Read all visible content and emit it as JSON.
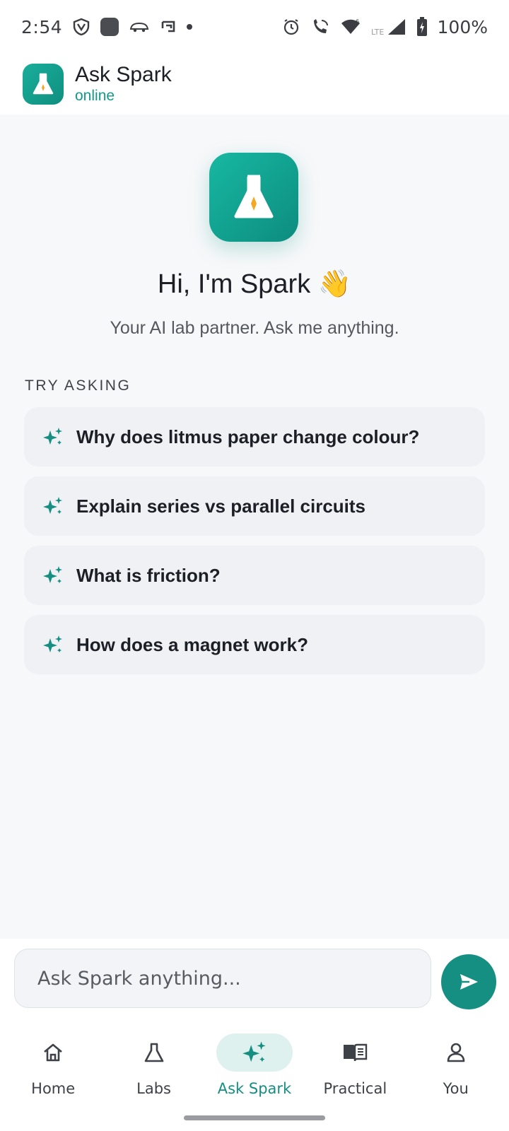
{
  "status_bar": {
    "time": "2:54",
    "battery": "100%",
    "network": "LTE"
  },
  "app_bar": {
    "title": "Ask Spark",
    "status": "online",
    "logo_icon": "flask-icon"
  },
  "hero": {
    "title": "Hi, I'm Spark 👋",
    "subtitle": "Your AI lab partner. Ask me anything."
  },
  "suggestions_section": {
    "label": "TRY ASKING",
    "items": [
      {
        "text": "Why does litmus paper change colour?",
        "icon": "sparkles-icon"
      },
      {
        "text": "Explain series vs parallel circuits",
        "icon": "sparkles-icon"
      },
      {
        "text": "What is friction?",
        "icon": "sparkles-icon"
      },
      {
        "text": "How does a magnet work?",
        "icon": "sparkles-icon"
      }
    ]
  },
  "composer": {
    "placeholder": "Ask Spark anything...",
    "value": "",
    "send_icon": "send-icon"
  },
  "bottom_nav": {
    "items": [
      {
        "label": "Home",
        "icon": "home-icon",
        "active": false
      },
      {
        "label": "Labs",
        "icon": "flask-icon",
        "active": false
      },
      {
        "label": "Ask Spark",
        "icon": "sparkles-icon",
        "active": true
      },
      {
        "label": "Practical",
        "icon": "book-icon",
        "active": false
      },
      {
        "label": "You",
        "icon": "person-icon",
        "active": false
      }
    ]
  },
  "colors": {
    "accent": "#148f82",
    "accent_light": "#dff1ee",
    "spark": "#f5a623",
    "background": "#f7f8fa"
  }
}
